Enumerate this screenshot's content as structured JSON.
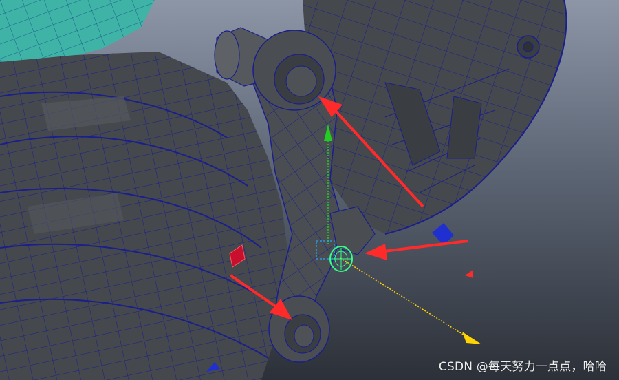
{
  "viewport": {
    "background_top": "#8d96a7",
    "background_bottom": "#2c3038",
    "mesh_fill": "#45484d",
    "mesh_fill_light": "#55585d",
    "wire_color": "#1a1f8c",
    "teal_object": "#3fb3a6"
  },
  "annotations": {
    "arrow_color": "#ff2b2b",
    "arrows": [
      "upper-right-arrow",
      "right-arrow",
      "lower-left-arrow"
    ]
  },
  "manipulator": {
    "y_axis_color": "#22cc22",
    "x_axis_color": "#ffd400",
    "selection_color": "#33ff88",
    "pivot_box_color": "#2aa6ff"
  },
  "watermark": {
    "text": "CSDN @每天努力一点点，哈哈"
  }
}
